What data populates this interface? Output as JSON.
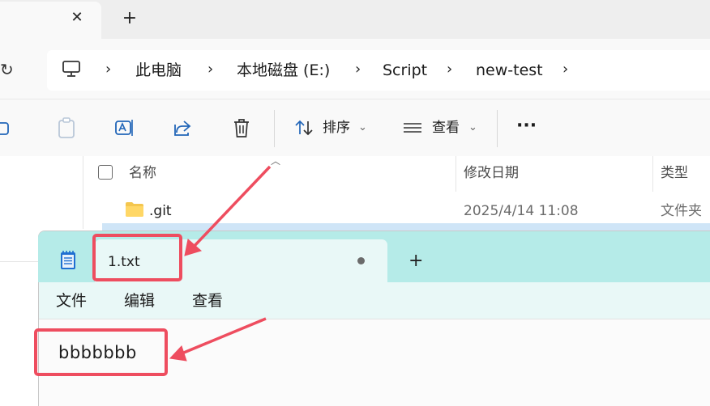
{
  "explorer": {
    "tab_close_glyph": "✕",
    "new_tab_glyph": "+",
    "refresh_glyph": "↻",
    "breadcrumb": {
      "separator": "›",
      "items": [
        "此电脑",
        "本地磁盘 (E:)",
        "Script",
        "new-test"
      ]
    },
    "toolbar": {
      "sort_label": "排序",
      "view_label": "查看",
      "more_glyph": "···",
      "chevron": "⌄"
    },
    "columns": {
      "name": "名称",
      "modified": "修改日期",
      "type": "类型"
    },
    "rows": [
      {
        "name": ".git",
        "modified": "2025/4/14 11:08",
        "type": "文件夹"
      }
    ]
  },
  "notepad": {
    "tab_title": "1.txt",
    "new_tab_glyph": "+",
    "menu": [
      "文件",
      "编辑",
      "查看"
    ],
    "content": "bbbbbbb"
  },
  "colors": {
    "annotation": "#ee4d5f",
    "notepad_titlebar": "#b5ebe8",
    "notepad_tab": "#e9f8f7",
    "folder": "#f4c64e"
  }
}
